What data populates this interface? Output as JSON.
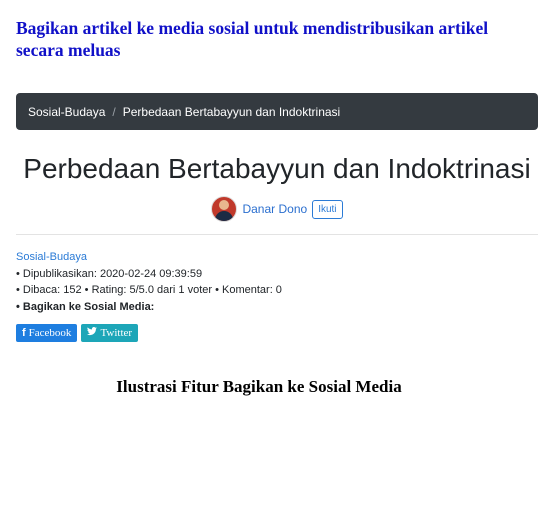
{
  "heading": "Bagikan artikel ke media sosial untuk mendistribusikan artikel secara meluas",
  "breadcrumb": {
    "items": [
      "Sosial-Budaya",
      "Perbedaan Bertabayyun dan Indoktrinasi"
    ],
    "separator": "/"
  },
  "article": {
    "title": "Perbedaan Bertabayyun dan Indoktrinasi",
    "author": "Danar Dono",
    "follow_label": "Ikuti",
    "category": "Sosial-Budaya",
    "published": "• Dipublikasikan: 2020-02-24 09:39:59",
    "stats": "• Dibaca: 152 • Rating: 5/5.0 dari 1 voter • Komentar: 0",
    "share_label": "• Bagikan ke Sosial Media:"
  },
  "share_buttons": {
    "facebook_icon": "f",
    "facebook": "Facebook",
    "twitter_icon": "🐦",
    "twitter": "Twitter"
  },
  "caption": "Ilustrasi Fitur Bagikan ke Sosial Media",
  "colors": {
    "heading": "#1010c8",
    "breadcrumb_bg": "#343a40",
    "link": "#2b7bd6",
    "facebook": "#1e7ee0",
    "twitter": "#1da6b8"
  }
}
